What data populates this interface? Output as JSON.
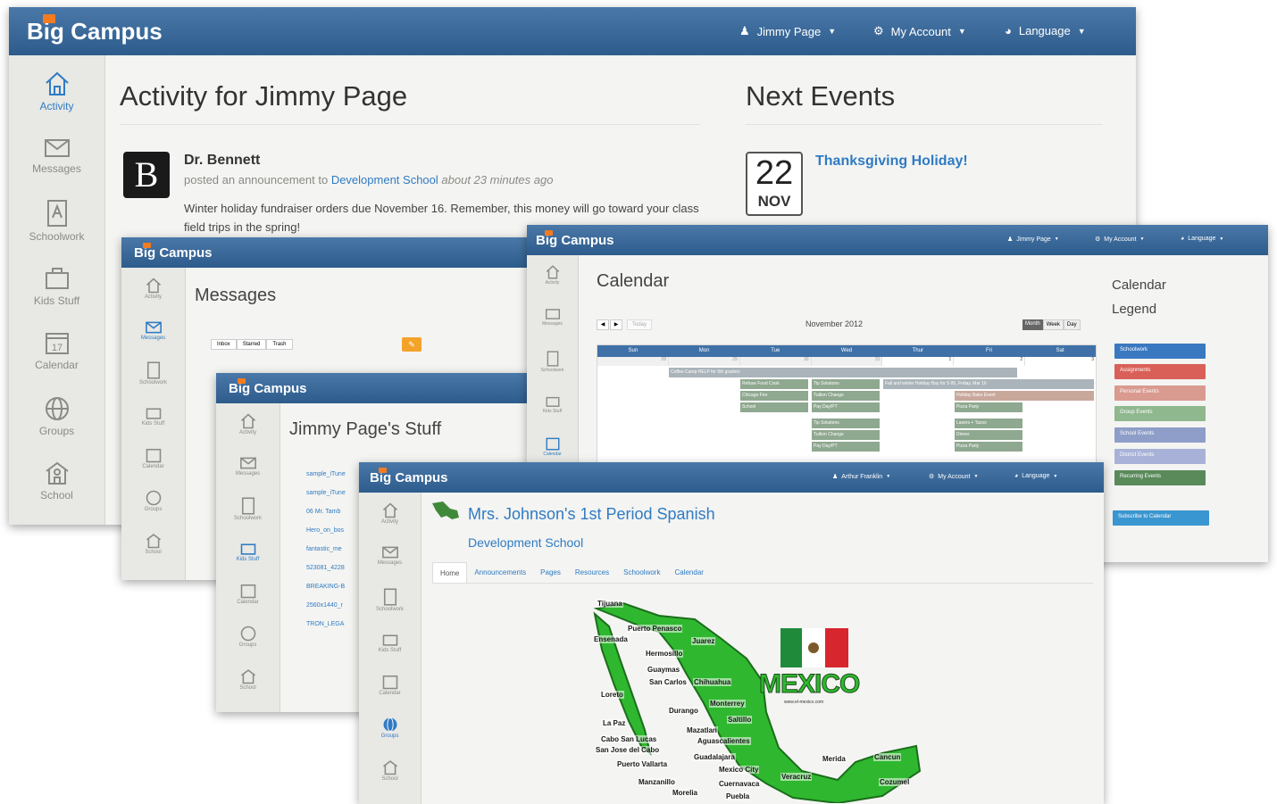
{
  "brand": {
    "name": "Big Campus",
    "accent": "#f47b20",
    "header_color": "#36649a",
    "link_color": "#2f7bc4"
  },
  "nav": {
    "user": "Jimmy Page",
    "account": "My Account",
    "language": "Language",
    "user_alt": "Arthur Franklin"
  },
  "sidebar": {
    "items": [
      {
        "label": "Activity",
        "icon": "home-icon"
      },
      {
        "label": "Messages",
        "icon": "envelope-icon"
      },
      {
        "label": "Schoolwork",
        "icon": "document-icon"
      },
      {
        "label": "Kids Stuff",
        "icon": "briefcase-icon"
      },
      {
        "label": "Calendar",
        "icon": "calendar-icon",
        "day": "17"
      },
      {
        "label": "Groups",
        "icon": "globe-icon"
      },
      {
        "label": "School",
        "icon": "school-icon"
      }
    ]
  },
  "activity": {
    "title": "Activity for Jimmy Page",
    "post": {
      "author": "Dr. Bennett",
      "avatar_letter": "B",
      "meta_prefix": "posted an announcement to",
      "meta_link": "Development School",
      "meta_time": "about 23 minutes ago",
      "body": "Winter holiday fundraiser orders due November 16. Remember, this money will go toward your class field trips in the spring!"
    }
  },
  "next_events": {
    "title": "Next Events",
    "event": {
      "day": "22",
      "month": "NOV",
      "name": "Thanksgiving Holiday!"
    }
  },
  "messages": {
    "title": "Messages",
    "tabs": [
      "Inbox",
      "Starred",
      "Trash"
    ]
  },
  "stuff": {
    "title": "Jimmy Page's Stuff",
    "files": [
      "sample_iTune",
      "sample_iTune",
      "06 Mr. Tamb",
      "Hero_on_bos",
      "fantastic_me",
      "523081_4228",
      "BREAKING-B",
      "2560x1440_r",
      "TRON_LEGA"
    ]
  },
  "calendar": {
    "title": "Calendar",
    "month": "November 2012",
    "today_label": "Today",
    "views": [
      "Month",
      "Week",
      "Day"
    ],
    "weekdays": [
      "Sun",
      "Mon",
      "Tue",
      "Wed",
      "Thur",
      "Fri",
      "Sat"
    ],
    "dates": [
      "28",
      "29",
      "30",
      "31",
      "1",
      "2",
      "3"
    ],
    "events": [
      "Coffee Camp HELP for 6th graders",
      "Refuse Food Cook",
      "Chicago Fire",
      "School",
      "Tip Solutions",
      "Tuition Change",
      "Pay Day/PT",
      "Fall and winter Holiday Bay for 5-95, Friday, Mar 16",
      "Holiday Bake Event",
      "Tip Solutions",
      "Tuition Change",
      "Pay Day/PT",
      "Pizza Party",
      "Lasers + Tacos",
      "Dinner",
      "Pizza Party"
    ],
    "legend_title": "Calendar Legend",
    "legend": [
      {
        "label": "Schoolwork",
        "color": "#3a78c0"
      },
      {
        "label": "Assignments",
        "color": "#d96058"
      },
      {
        "label": "Personal Events",
        "color": "#d99a90"
      },
      {
        "label": "Group Events",
        "color": "#8fb88e"
      },
      {
        "label": "School Events",
        "color": "#8e9ec8"
      },
      {
        "label": "District Events",
        "color": "#a8b2d8"
      },
      {
        "label": "Recurring Events",
        "color": "#5a8a5a"
      }
    ],
    "subscribe": "Subscribe to Calendar"
  },
  "spanish": {
    "title": "Mrs. Johnson's 1st Period Spanish",
    "school": "Development School",
    "tabs": [
      "Home",
      "Announcements",
      "Pages",
      "Resources",
      "Schoolwork",
      "Calendar"
    ],
    "map_word": "MEXICO",
    "map_caption": "www.el-mexico.com",
    "cities": [
      "Tijuana",
      "Puerto Penasco",
      "Ensenada",
      "Juarez",
      "Hermosillo",
      "Guaymas",
      "San Carlos",
      "Chihuahua",
      "Loreto",
      "Monterrey",
      "Durango",
      "Saltillo",
      "La Paz",
      "Mazatlan",
      "Aguascalientes",
      "Cabo San Lucas",
      "San Jose del Cabo",
      "Guadalajara",
      "Puerto Vallarta",
      "Mexico City",
      "Manzanillo",
      "Veracruz",
      "Cuernavaca",
      "Morelia",
      "Puebla",
      "Merida",
      "Cancun",
      "Cozumel"
    ]
  }
}
